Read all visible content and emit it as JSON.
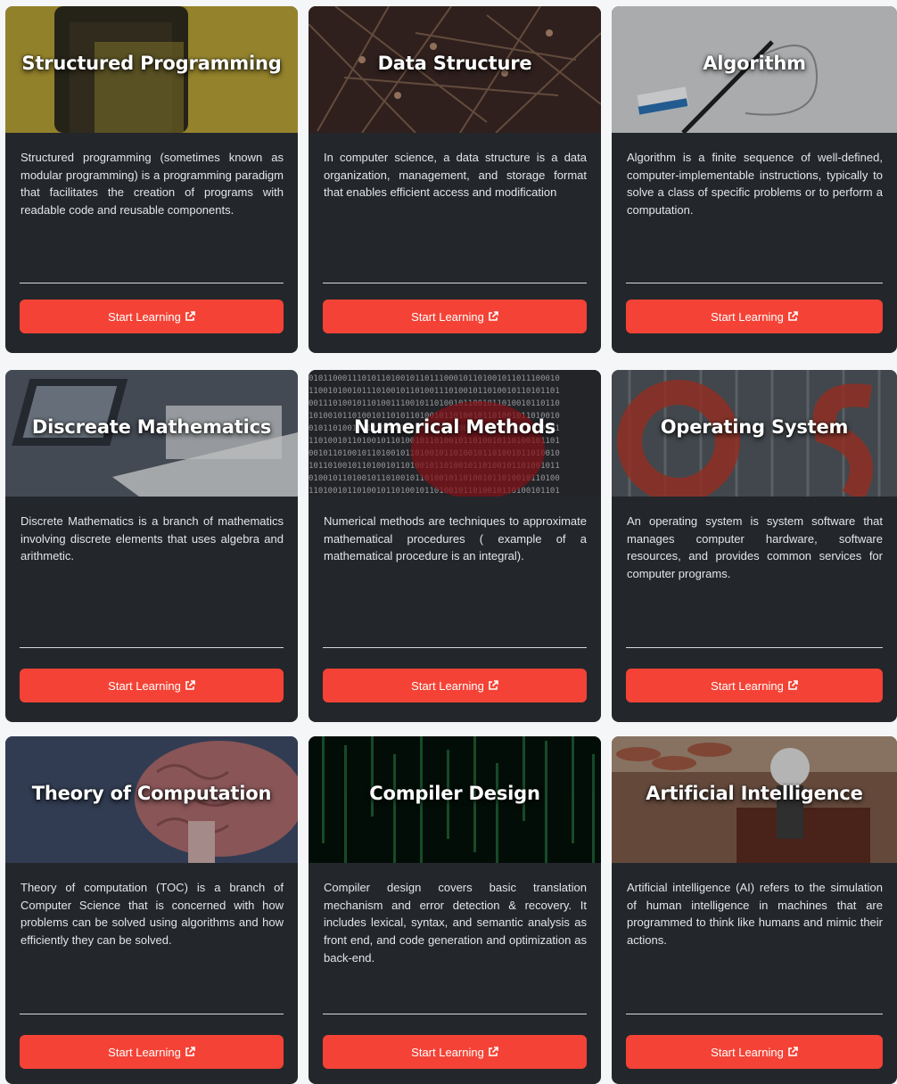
{
  "courses": [
    {
      "title": "Structured Programming",
      "description": "Structured programming (sometimes known as modular programming) is a programming paradigm that facilitates the creation of programs with readable code and reusable components.",
      "button_label": "Start Learning",
      "image_icon": "keyboard-photo",
      "image_colors": [
        "#8a7a2a",
        "#b9a23a",
        "#2e2a1a"
      ]
    },
    {
      "title": "Data Structure",
      "description": "In computer science, a data structure is a data organization, management, and storage format that enables efficient access and modification",
      "button_label": "Start Learning",
      "image_icon": "network-photo",
      "image_colors": [
        "#3a2824",
        "#6b4a3e",
        "#1c1614"
      ]
    },
    {
      "title": "Algorithm",
      "description": "Algorithm is a finite sequence of well-defined, computer-implementable instructions, typically to solve a class of specific problems or to perform a computation.",
      "button_label": "Start Learning",
      "image_icon": "whiteboard-photo",
      "image_colors": [
        "#c9cbce",
        "#9ea1a5",
        "#d8dadc"
      ]
    },
    {
      "title": "Discreate Mathematics",
      "description": "Discrete Mathematics is a branch of mathematics involving discrete elements that uses algebra and arithmetic.",
      "button_label": "Start Learning",
      "image_icon": "desk-photo",
      "image_colors": [
        "#4a5360",
        "#6f7884",
        "#2d333b"
      ]
    },
    {
      "title": "Numerical Methods",
      "description": "Numerical methods are techniques to approximate mathematical procedures ( example of a mathematical procedure is an integral).",
      "button_label": "Start Learning",
      "image_icon": "binary-photo",
      "image_colors": [
        "#1f2226",
        "#7a1f22",
        "#3a3e44"
      ]
    },
    {
      "title": "Operating System",
      "description": "An operating system is system software that manages computer hardware, software resources, and provides common services for computer programs.",
      "button_label": "Start Learning",
      "image_icon": "wall-photo",
      "image_colors": [
        "#4b5257",
        "#9a3b2f",
        "#2f3438"
      ]
    },
    {
      "title": "Theory of Computation",
      "description": "Theory of computation (TOC) is a branch of Computer Science that is concerned with how problems can be solved using algorithms and how efficiently they can be solved.",
      "button_label": "Start Learning",
      "image_icon": "brain-photo",
      "image_colors": [
        "#3b4660",
        "#a4676a",
        "#252b3a"
      ]
    },
    {
      "title": "Compiler Design",
      "description": "Compiler design covers basic translation mechanism and error detection & recovery. It includes lexical, syntax, and semantic analysis as front end, and code generation and optimization as back-end.",
      "button_label": "Start Learning",
      "image_icon": "matrix-code-photo",
      "image_colors": [
        "#061a12",
        "#1f6b3c",
        "#020806"
      ]
    },
    {
      "title": "Artificial Intelligence",
      "description": "Artificial intelligence (AI) refers to the simulation of human intelligence in machines that are programmed to think like humans and mimic their actions.",
      "button_label": "Start Learning",
      "image_icon": "robot-photo",
      "image_colors": [
        "#6a4a3a",
        "#9a7a63",
        "#3a2a22"
      ]
    }
  ],
  "colors": {
    "card_bg": "#23272b",
    "button_bg": "#f44336",
    "page_bg": "#f5f6f7"
  }
}
